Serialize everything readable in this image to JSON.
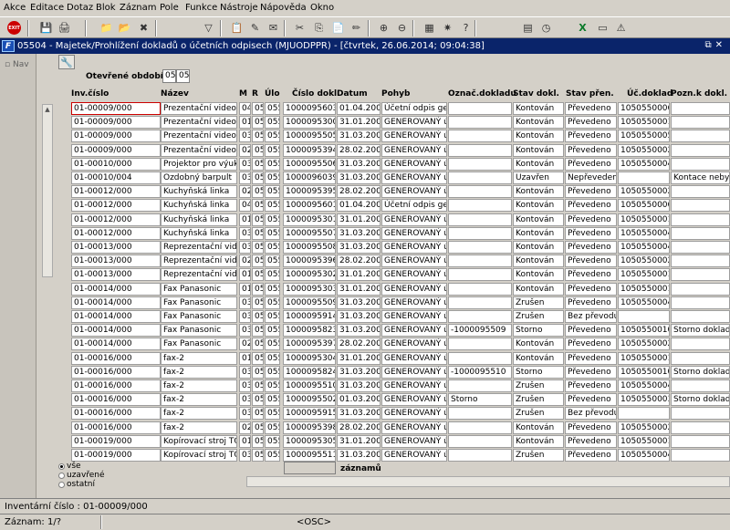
{
  "menu": [
    "Akce",
    "Editace",
    "Dotaz",
    "Blok",
    "Záznam",
    "Pole",
    "Funkce",
    "Nástroje",
    "Nápověda",
    "Okno"
  ],
  "toolbar_icons": [
    "exit-icon",
    "save-icon",
    "print-icon",
    "enter-query-icon",
    "execute-query-icon",
    "cancel-query-icon",
    "filter-icon",
    "clipboard-icon",
    "note-icon",
    "mail-icon",
    "cut-icon",
    "copy-icon",
    "paste-icon",
    "edit-icon",
    "insert-record-icon",
    "delete-record-icon",
    "calculator-icon",
    "settings-icon",
    "help-icon",
    "report-icon",
    "clock-icon",
    "excel-icon",
    "document-icon",
    "warning-icon"
  ],
  "exit_label": "EXIT",
  "window": {
    "title": "05504 - Majetek/Prohlížení dokladů o účetních odpisech (MJUODPPR) - [čtvrtek, 26.06.2014; 09:04:38]",
    "logo": "F"
  },
  "nav": {
    "label": "Nav"
  },
  "period": {
    "label": "Otevřené období",
    "month": "05",
    "year": "05"
  },
  "headers": [
    "Inv.číslo",
    "Název",
    "M",
    "R",
    "Úlo",
    "Číslo dokl.",
    "Datum",
    "Pohyb",
    "Označ.dokladu",
    "Stav dokl.",
    "Stav přen.",
    "Úč.doklad",
    "Pozn.k dokl."
  ],
  "rows": [
    [
      "01-00009/000",
      "Prezentační video-p",
      "04",
      "05",
      "055",
      "1000095603",
      "01.04.2005",
      "Účetní odpis gene",
      "",
      "Kontován",
      "Převedeno",
      "1050550006",
      ""
    ],
    [
      "01-00009/000",
      "Prezentační video-p",
      "01",
      "05",
      "055",
      "1000095300",
      "31.01.2005",
      "GENEROVANÝ úč",
      "",
      "Kontován",
      "Převedeno",
      "1050550001",
      ""
    ],
    [
      "01-00009/000",
      "Prezentační video-p",
      "03",
      "05",
      "055",
      "1000095505",
      "31.03.2005",
      "GENEROVANÝ úč",
      "",
      "Kontován",
      "Převedeno",
      "1050550005",
      ""
    ],
    [
      "01-00009/000",
      "Prezentační video-p",
      "02",
      "05",
      "055",
      "1000095394",
      "28.02.2005",
      "GENEROVANÝ úč",
      "",
      "Kontován",
      "Převedeno",
      "1050550002",
      ""
    ],
    [
      "01-00010/000",
      "Projektor pro výuku",
      "03",
      "05",
      "055",
      "1000095506",
      "31.03.2005",
      "GENEROVANÝ úč",
      "",
      "Kontován",
      "Převedeno",
      "1050550004",
      ""
    ],
    [
      "01-00010/004",
      "Ozdobný barpult",
      "03",
      "05",
      "055",
      "1000096039",
      "31.03.2005",
      "GENEROVANÝ úč",
      "",
      "Uzavřen",
      "Nepřevedeno",
      "",
      "Kontace nebyla"
    ],
    [
      "01-00012/000",
      "Kuchyňská linka",
      "02",
      "05",
      "055",
      "1000095395",
      "28.02.2005",
      "GENEROVANÝ úč",
      "",
      "Kontován",
      "Převedeno",
      "1050550002",
      ""
    ],
    [
      "01-00012/000",
      "Kuchyňská linka",
      "04",
      "05",
      "055",
      "1000095601",
      "01.04.2005",
      "Účetní odpis gene",
      "",
      "Kontován",
      "Převedeno",
      "1050550006",
      ""
    ],
    [
      "01-00012/000",
      "Kuchyňská linka",
      "01",
      "05",
      "055",
      "1000095301",
      "31.01.2005",
      "GENEROVANÝ úč",
      "",
      "Kontován",
      "Převedeno",
      "1050550001",
      ""
    ],
    [
      "01-00012/000",
      "Kuchyňská linka",
      "03",
      "05",
      "055",
      "1000095507",
      "31.03.2005",
      "GENEROVANÝ úč",
      "",
      "Kontován",
      "Převedeno",
      "1050550004",
      ""
    ],
    [
      "01-00013/000",
      "Reprezentační vide",
      "03",
      "05",
      "055",
      "1000095508",
      "31.03.2005",
      "GENEROVANÝ úč",
      "",
      "Kontován",
      "Převedeno",
      "1050550004",
      ""
    ],
    [
      "01-00013/000",
      "Reprezentační vide",
      "02",
      "05",
      "055",
      "1000095396",
      "28.02.2005",
      "GENEROVANÝ úč",
      "",
      "Kontován",
      "Převedeno",
      "1050550002",
      ""
    ],
    [
      "01-00013/000",
      "Reprezentační vide",
      "01",
      "05",
      "055",
      "1000095302",
      "31.01.2005",
      "GENEROVANÝ úč",
      "",
      "Kontován",
      "Převedeno",
      "1050550001",
      ""
    ],
    [
      "01-00014/000",
      "Fax Panasonic",
      "01",
      "05",
      "055",
      "1000095303",
      "31.01.2005",
      "GENEROVANÝ úč",
      "",
      "Kontován",
      "Převedeno",
      "1050550001",
      ""
    ],
    [
      "01-00014/000",
      "Fax Panasonic",
      "03",
      "05",
      "055",
      "1000095509",
      "31.03.2005",
      "GENEROVANÝ úč",
      "",
      "Zrušen",
      "Převedeno",
      "1050550004",
      ""
    ],
    [
      "01-00014/000",
      "Fax Panasonic",
      "03",
      "05",
      "055",
      "1000095914",
      "31.03.2005",
      "GENEROVANÝ úč",
      "",
      "Zrušen",
      "Bez převodu d",
      "",
      ""
    ],
    [
      "01-00014/000",
      "Fax Panasonic",
      "03",
      "05",
      "055",
      "1000095823",
      "31.03.2005",
      "GENEROVANÝ úč",
      "-1000095509",
      "Storno",
      "Převedeno",
      "1050550010",
      "Storno dokladu"
    ],
    [
      "01-00014/000",
      "Fax Panasonic",
      "02",
      "05",
      "055",
      "1000095397",
      "28.02.2005",
      "GENEROVANÝ úč",
      "",
      "Kontován",
      "Převedeno",
      "1050550002",
      ""
    ],
    [
      "01-00016/000",
      "fax-2",
      "01",
      "05",
      "055",
      "1000095304",
      "31.01.2005",
      "GENEROVANÝ úč",
      "",
      "Kontován",
      "Převedeno",
      "1050550001",
      ""
    ],
    [
      "01-00016/000",
      "fax-2",
      "03",
      "05",
      "055",
      "1000095824",
      "31.03.2005",
      "GENEROVANÝ úč",
      "-1000095510",
      "Storno",
      "Převedeno",
      "1050550010",
      "Storno dokladu"
    ],
    [
      "01-00016/000",
      "fax-2",
      "03",
      "05",
      "055",
      "1000095510",
      "31.03.2005",
      "GENEROVANÝ úč",
      "",
      "Zrušen",
      "Převedeno",
      "1050550004",
      ""
    ],
    [
      "01-00016/000",
      "fax-2",
      "03",
      "05",
      "055",
      "1000095502",
      "01.03.2005",
      "GENEROVANÝ úč",
      "Storno",
      "Zrušen",
      "Převedeno",
      "1050550003",
      "Storno dokladu"
    ],
    [
      "01-00016/000",
      "fax-2",
      "03",
      "05",
      "055",
      "1000095915",
      "31.03.2005",
      "GENEROVANÝ úč",
      "",
      "Zrušen",
      "Bez převodu d",
      "",
      ""
    ],
    [
      "01-00016/000",
      "fax-2",
      "02",
      "05",
      "055",
      "1000095398",
      "28.02.2005",
      "GENEROVANÝ úč",
      "",
      "Kontován",
      "Převedeno",
      "1050550002",
      ""
    ],
    [
      "01-00019/000",
      "Kopírovací stroj TOS",
      "01",
      "05",
      "055",
      "1000095305",
      "31.01.2005",
      "GENEROVANÝ úč",
      "",
      "Kontován",
      "Převedeno",
      "1050550001",
      ""
    ],
    [
      "01-00019/000",
      "Kopírovací stroj TOS",
      "03",
      "05",
      "055",
      "1000095511",
      "31.03.2005",
      "GENEROVANÝ úč",
      "",
      "Zrušen",
      "Převedeno",
      "1050550004",
      ""
    ]
  ],
  "filter": {
    "options": [
      "vše",
      "uzavřené",
      "ostatní"
    ],
    "selected": "vše"
  },
  "record_count_label": "záznamů",
  "status": {
    "field": "Inventární číslo : 01-00009/000",
    "record": "Záznam: 1/?",
    "mode": "<OSC>"
  }
}
